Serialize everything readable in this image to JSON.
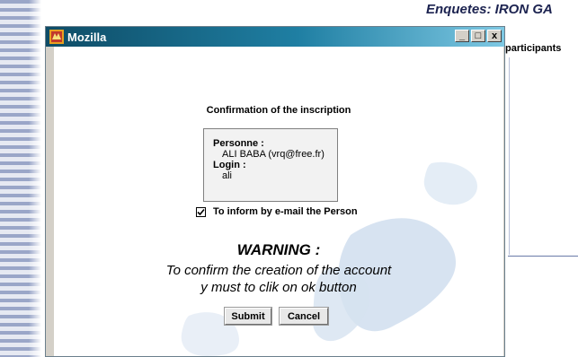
{
  "background_page": {
    "title": "Enquetes: IRON GA",
    "participants_label": "participants"
  },
  "window": {
    "title": "Mozilla",
    "icon": "mozilla-app-icon",
    "controls": {
      "minimize": "_",
      "maximize": "□",
      "close": "x"
    }
  },
  "dialog": {
    "title": "Confirmation of the inscription",
    "person": {
      "personne_label": "Personne :",
      "personne_value": "ALI BABA (vrq@free.fr)",
      "login_label": "Login :",
      "login_value": "ali"
    },
    "inform_checkbox": {
      "label": "To inform by e-mail the Person",
      "checked": true
    },
    "warning": {
      "title": "WARNING :",
      "line1": "To confirm the creation of the account",
      "line2": "y must to clik on ok button"
    },
    "buttons": {
      "submit": "Submit",
      "cancel": "Cancel"
    }
  },
  "colors": {
    "titlebar_start": "#0e4c66",
    "titlebar_end": "#7ec8e3",
    "map_tint": "#c9d9ec"
  }
}
